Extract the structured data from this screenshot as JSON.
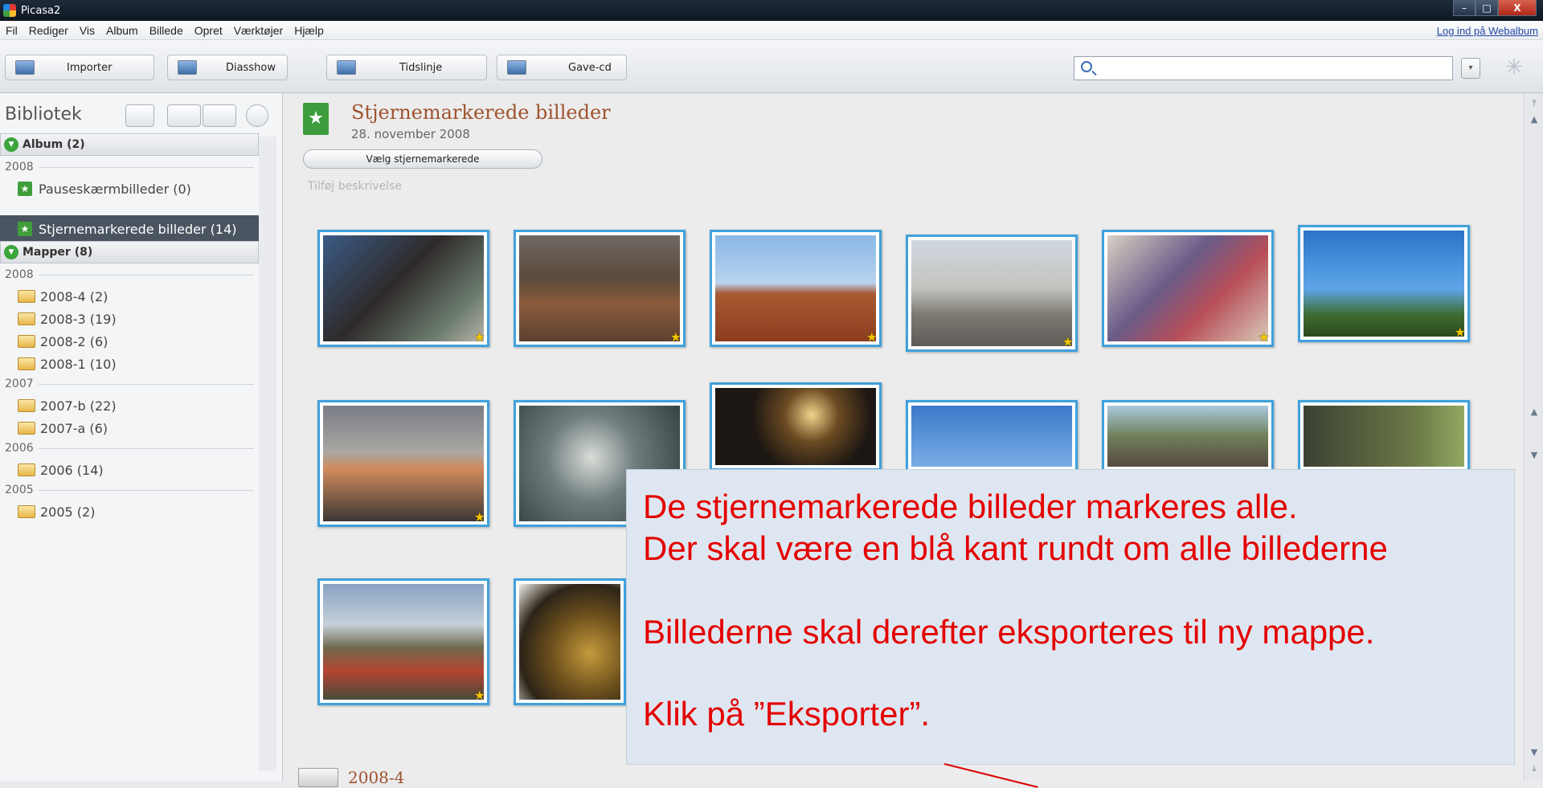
{
  "window": {
    "title": "Picasa2",
    "min": "–",
    "max": "□",
    "close": "X"
  },
  "menu": {
    "items": [
      "Fil",
      "Rediger",
      "Vis",
      "Album",
      "Billede",
      "Opret",
      "Værktøjer",
      "Hjælp"
    ],
    "login": "Log ind på Webalbum"
  },
  "toolbar": {
    "import": "Importer",
    "slideshow": "Diasshow",
    "timeline": "Tidslinje",
    "giftcd": "Gave-cd",
    "search_dropdown": "▾"
  },
  "sidebar": {
    "title": "Bibliotek",
    "album_section": "Album (2)",
    "album_year": "2008",
    "albums": [
      "Pauseskærmbilleder (0)",
      "Stjernemarkerede billeder (14)"
    ],
    "folder_section": "Mapper (8)",
    "years": [
      "2008",
      "2007",
      "2006",
      "2005"
    ],
    "folders_2008": [
      "2008-4 (2)",
      "2008-3 (19)",
      "2008-2 (6)",
      "2008-1 (10)"
    ],
    "folders_2007": [
      "2007-b (22)",
      "2007-a (6)"
    ],
    "folders_2006": [
      "2006 (14)"
    ],
    "folders_2005": [
      "2005 (2)"
    ]
  },
  "main": {
    "album_title": "Stjernemarkerede billeder",
    "album_date": "28. november 2008",
    "select_starred": "Vælg stjernemarkerede",
    "add_description": "Tilføj beskrivelse",
    "next_folder": "2008-4"
  },
  "callout": {
    "line1": "De stjernemarkerede billeder markeres alle.",
    "line2": "Der skal være en blå kant rundt om alle billederne",
    "line3": "Billederne skal derefter eksporteres til ny mappe.",
    "line4": "Klik på ”Eksporter”."
  },
  "colors": {
    "selection_border": "#3fa1dc",
    "callout_text": "#e50000",
    "album_title": "#a0522d"
  }
}
